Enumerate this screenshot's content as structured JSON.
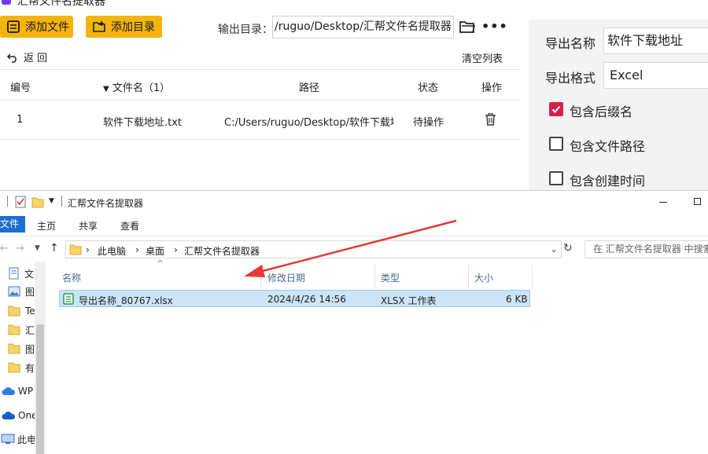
{
  "app": {
    "title": "汇帮文件名提取器",
    "toolbar": {
      "add_file": "添加文件",
      "add_dir": "添加目录",
      "output_label": "输出目录：",
      "output_path": "/ruguo/Desktop/汇帮文件名提取器",
      "more": "•••"
    },
    "back": "返  回",
    "clear_list": "清空列表",
    "table": {
      "headers": {
        "index": "编号",
        "filename": "文件名（1）",
        "path": "路径",
        "status": "状态",
        "action": "操作"
      },
      "rows": [
        {
          "index": "1",
          "filename": "软件下载地址.txt",
          "path": "C:/Users/ruguo/Desktop/软件下载地址",
          "status": "待操作"
        }
      ]
    },
    "panel": {
      "export_name_label": "导出名称",
      "export_name_value": "软件下载地址",
      "export_format_label": "导出格式",
      "export_format_value": "Excel",
      "options": [
        {
          "label": "包含后缀名",
          "checked": true
        },
        {
          "label": "包含文件路径",
          "checked": false
        },
        {
          "label": "包含创建时间",
          "checked": false
        }
      ]
    }
  },
  "explorer": {
    "title": "汇帮文件名提取器",
    "ribbon": {
      "file": "文件",
      "home": "主页",
      "share": "共享",
      "view": "查看"
    },
    "address": {
      "this_pc": "此电脑",
      "desktop": "桌面",
      "folder": "汇帮文件名提取器"
    },
    "search_placeholder": "在 汇帮文件名提取器 中搜索",
    "nav_items": [
      "文",
      "图",
      "Te",
      "汇",
      "图",
      "有",
      "WP",
      "One",
      "此电"
    ],
    "columns": {
      "name": "名称",
      "modified": "修改日期",
      "type": "类型",
      "size": "大小"
    },
    "files": [
      {
        "name": "导出名称_80767.xlsx",
        "modified": "2024/4/26 14:56",
        "type": "XLSX 工作表",
        "size": "6 KB"
      }
    ]
  },
  "colors": {
    "accent_yellow": "#f5b40b",
    "checkbox_red": "#d6204b",
    "arrow_red": "#e53935",
    "selection_blue": "#cce4f7"
  }
}
